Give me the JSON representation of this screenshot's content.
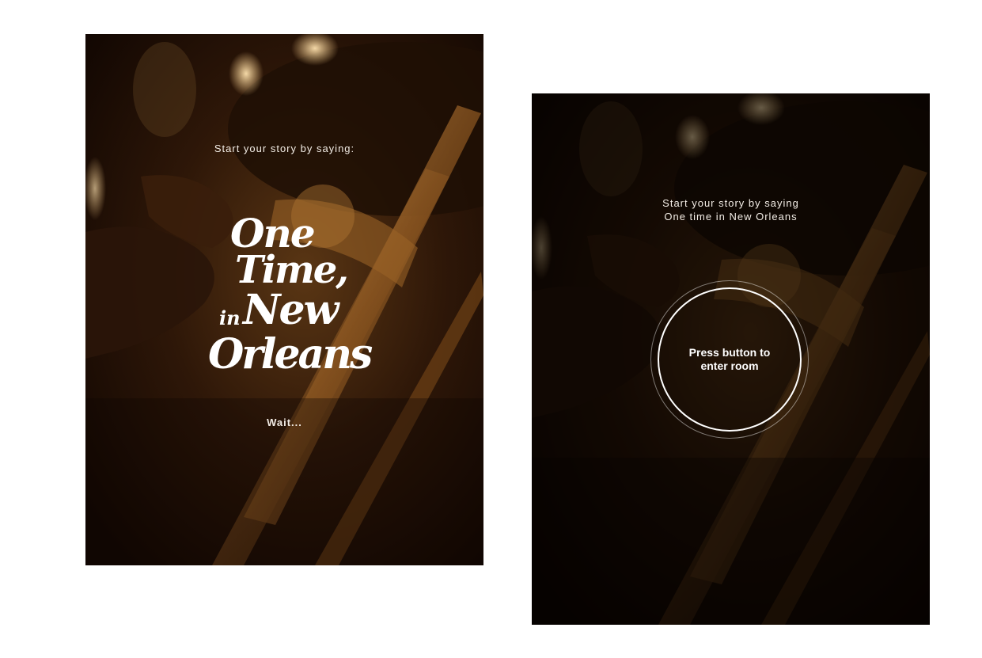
{
  "left_screen": {
    "prompt": "Start your story by saying:",
    "logo": {
      "line1": "One",
      "line2": "Time,",
      "line3": "in",
      "line4": "New",
      "line5": "Orleans"
    },
    "status": "Wait..."
  },
  "right_screen": {
    "prompt_line1": "Start your story by saying",
    "prompt_line2": "One time in New Orleans",
    "button_label": "Press button to enter room"
  },
  "colors": {
    "page_background": "#ffffff",
    "text": "#f3ede6",
    "photo_shadow": "#1a0d05",
    "brass_highlight": "#c98a3a"
  }
}
